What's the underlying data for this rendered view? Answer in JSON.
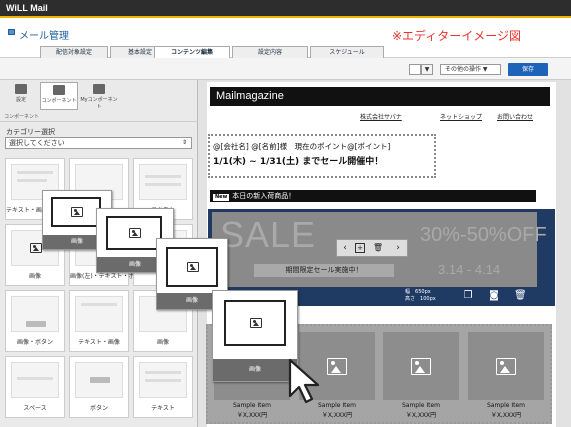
{
  "app": {
    "logo": "WiLL Mail",
    "title": "メール管理",
    "editor_note": "※エディターイメージ図"
  },
  "tabs": [
    {
      "label": "配信対象設定",
      "active": false
    },
    {
      "label": "基本設定",
      "active": false
    },
    {
      "label": "コンテンツ編集",
      "active": true
    },
    {
      "label": "設定内容",
      "active": false
    },
    {
      "label": "スケジュール",
      "active": false
    }
  ],
  "toolbar": {
    "dropdown_arrow": "▼",
    "other_actions": "その他の操作 ▼",
    "save": "保存"
  },
  "sidebar": {
    "tabs": [
      {
        "label": "設定",
        "icon": "wrench-icon"
      },
      {
        "label": "コンポーネント",
        "icon": "layers-icon",
        "active": true
      },
      {
        "label": "Myコンポーネント",
        "icon": "puzzle-icon"
      }
    ],
    "section": "コンポーネント",
    "category_label": "カテゴリー選択",
    "category_value": "選択してください",
    "tiles": [
      "テキスト・画像・ボタン",
      "画像",
      "テキスト",
      "画像",
      "画像(左)・テキスト・ボタン",
      "画像",
      "画像・ボタン",
      "テキスト・画像",
      "画像",
      "スペース",
      "ボタン",
      "テキスト"
    ],
    "drag_caption": "画像"
  },
  "mail": {
    "header": "Mailmagazine",
    "links": [
      "株式会社サパナ",
      "ネットショップ",
      "お問い合わせ"
    ],
    "greeting_line1": "@[会社名] @[名前]様　現在のポイント@[ポイント]",
    "greeting_line2": "1/1(木) ~ 1/31(土) までセール開催中！",
    "new_tag": "New",
    "new_text": "本日の新入荷商品！",
    "banner": {
      "sale": "SALE",
      "percent": "30%-50%OFF",
      "sub": "期間限定セール実施中！",
      "date": "3.14 - 4.14",
      "width_label": "幅",
      "width_value": "650px",
      "height_label": "高さ",
      "height_value": "100px"
    },
    "items": [
      {
        "name": "Sample Item",
        "price": "￥X,XXX円"
      },
      {
        "name": "Sample Item",
        "price": "￥X,XXX円"
      },
      {
        "name": "Sample Item",
        "price": "￥X,XXX円"
      },
      {
        "name": "Sample Item",
        "price": "￥X,XXX円"
      }
    ]
  },
  "colors": {
    "accent": "#1d63b8",
    "note": "#e8342c",
    "banner_frame": "#1f3a63"
  }
}
